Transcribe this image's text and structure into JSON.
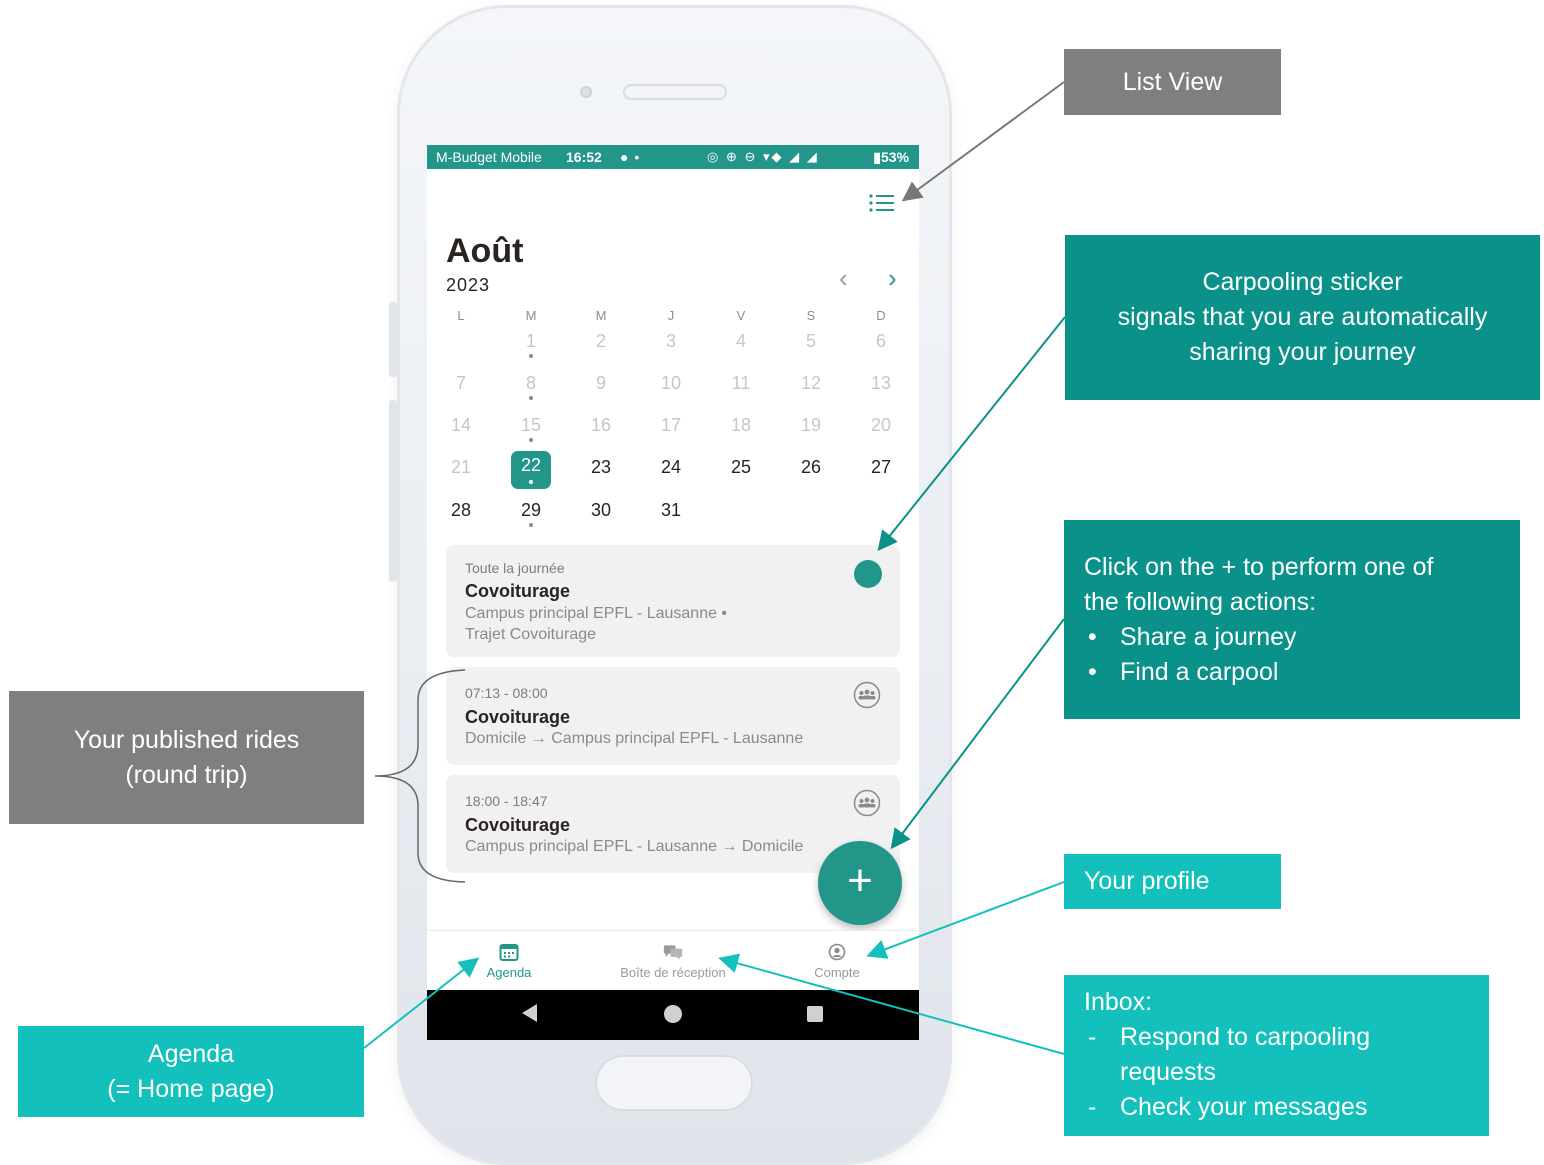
{
  "status_bar": {
    "carrier": "M-Budget Mobile",
    "time": "16:52",
    "icons_left": "● •",
    "icons_right": "◎ ⊕ ⊖ ▾◆ ◢ ◢",
    "battery": "▮53%"
  },
  "calendar": {
    "month": "Août",
    "year": "2023",
    "weekdays": [
      "L",
      "M",
      "M",
      "J",
      "V",
      "S",
      "D"
    ],
    "selected_day": "22",
    "weeks": [
      [
        "",
        "1",
        "2",
        "3",
        "4",
        "5",
        "6"
      ],
      [
        "7",
        "8",
        "9",
        "10",
        "11",
        "12",
        "13"
      ],
      [
        "14",
        "15",
        "16",
        "17",
        "18",
        "19",
        "20"
      ],
      [
        "21",
        "22",
        "23",
        "24",
        "25",
        "26",
        "27"
      ],
      [
        "28",
        "29",
        "30",
        "31",
        "",
        "",
        ""
      ]
    ]
  },
  "events": [
    {
      "time": "Toute la journée",
      "title": "Covoiturage",
      "line1": "Campus principal EPFL - Lausanne •",
      "line2": "Trajet Covoiturage",
      "indicator": "carpool-sticker"
    },
    {
      "time": "07:13 - 08:00",
      "title": "Covoiturage",
      "line1": "Domicile → Campus principal EPFL - Lausanne",
      "indicator": "group-icon"
    },
    {
      "time": "18:00 - 18:47",
      "title": "Covoiturage",
      "line1": "Campus principal EPFL - Lausanne → Domicile",
      "indicator": "group-icon"
    }
  ],
  "fab": {
    "label": "+"
  },
  "tabs": [
    {
      "label": "Agenda",
      "icon": "calendar-icon",
      "active": true
    },
    {
      "label": "Boîte de réception",
      "icon": "chat-icon",
      "active": false
    },
    {
      "label": "Compte",
      "icon": "account-icon",
      "active": false
    }
  ],
  "annotations": {
    "list_view": "List View",
    "sticker": [
      "Carpooling sticker",
      "signals that you are automatically",
      "sharing your journey"
    ],
    "plus": {
      "intro": [
        "Click on the + to perform one of",
        "the following actions:"
      ],
      "bullets": [
        "Share a journey",
        "Find a carpool"
      ],
      "marker": "•"
    },
    "rides": [
      "Your published rides",
      "(round trip)"
    ],
    "profile": "Your profile",
    "inbox": {
      "title": "Inbox:",
      "items": [
        "Respond to carpooling",
        "requests",
        "Check your messages"
      ],
      "marker": "-"
    },
    "agenda": [
      "Agenda",
      "(= Home page)"
    ]
  },
  "colors": {
    "primary": "#23968a",
    "annotation_gray": "#7f7f7f",
    "annotation_dark_teal": "#0a918a",
    "annotation_cyan": "#13c0bc"
  }
}
